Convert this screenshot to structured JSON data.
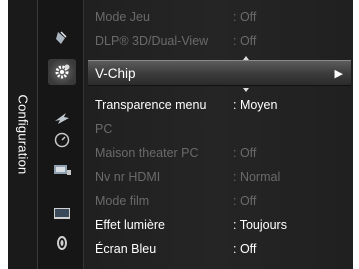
{
  "side_tab": {
    "label": "Configuration"
  },
  "icons": [
    {
      "name": "picture-icon"
    },
    {
      "name": "setup-icon"
    },
    {
      "name": "input-icon"
    },
    {
      "name": "clock-icon"
    },
    {
      "name": "support-icon"
    },
    {
      "name": "display-icon"
    },
    {
      "name": "sound-icon"
    }
  ],
  "menu": {
    "items": [
      {
        "label": "Mode Jeu",
        "value": ": Off",
        "state": "dim"
      },
      {
        "label": "DLP® 3D/Dual-View",
        "value": ": Off",
        "state": "dim"
      },
      {
        "label": "V-Chip",
        "value": "",
        "state": "selected",
        "arrow": "▶"
      },
      {
        "label": "Transparence menu",
        "value": ": Moyen",
        "state": "bright"
      },
      {
        "label": "PC",
        "value": "",
        "state": "dim"
      },
      {
        "label": "Maison theater PC",
        "value": ": Off",
        "state": "dim"
      },
      {
        "label": "Nv nr HDMI",
        "value": ": Normal",
        "state": "dim"
      },
      {
        "label": "Mode film",
        "value": ": Off",
        "state": "dim"
      },
      {
        "label": "Effet lumière",
        "value": ": Toujours",
        "state": "bright"
      },
      {
        "label": "Écran Bleu",
        "value": ": Off",
        "state": "bright"
      }
    ]
  }
}
